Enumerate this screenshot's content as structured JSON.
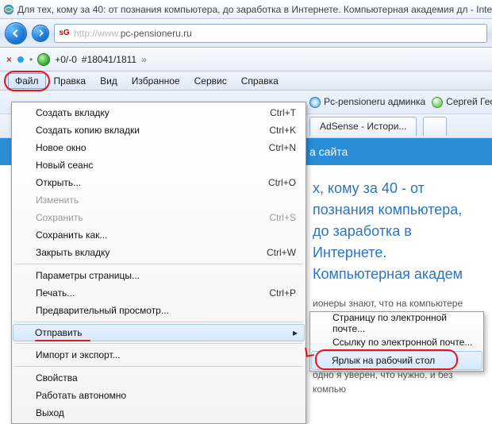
{
  "window": {
    "title": "Для тех, кому за 40: от познания компьютера, до заработка в Интернете. Компьютерная академия дл - Inte"
  },
  "address": {
    "favicon_label": "sG",
    "url_display": "pc-pensioneru.ru",
    "url_prefix": "http://www."
  },
  "toolbar2": {
    "close_x": "×",
    "zoom": "+0/-0",
    "counter": "#18041/1811",
    "chev": "»"
  },
  "menubar": {
    "file": "Файл",
    "edit": "Правка",
    "view": "Вид",
    "favorites": "Избранное",
    "tools": "Сервис",
    "help": "Справка"
  },
  "linksbar": {
    "item1": "Pc-pensioneru админка",
    "item2": "Сергей Гео"
  },
  "tabsbar": {
    "tab1": "AdSense - Истори..."
  },
  "page": {
    "bluebar": "а сайта",
    "heading": "х, кому за 40 - от познания компьютера, до заработка в Интернете. Компьютерная академ",
    "p1": "ионеры знают, что на компьютере можно играть в разные игры. О других возможностях большинство не знает и",
    "p2": "одно я уверен, что нужно, и без компью"
  },
  "file_menu": [
    {
      "label": "Создать вкладку",
      "shortcut": "Ctrl+T",
      "enabled": true
    },
    {
      "label": "Создать копию вкладки",
      "shortcut": "Ctrl+K",
      "enabled": true
    },
    {
      "label": "Новое окно",
      "shortcut": "Ctrl+N",
      "enabled": true
    },
    {
      "label": "Новый сеанс",
      "shortcut": "",
      "enabled": true
    },
    {
      "label": "Открыть...",
      "shortcut": "Ctrl+O",
      "enabled": true
    },
    {
      "label": "Изменить",
      "shortcut": "",
      "enabled": false
    },
    {
      "label": "Сохранить",
      "shortcut": "Ctrl+S",
      "enabled": false
    },
    {
      "label": "Сохранить как...",
      "shortcut": "",
      "enabled": true
    },
    {
      "label": "Закрыть вкладку",
      "shortcut": "Ctrl+W",
      "enabled": true
    },
    {
      "sep": true
    },
    {
      "label": "Параметры страницы...",
      "shortcut": "",
      "enabled": true
    },
    {
      "label": "Печать...",
      "shortcut": "Ctrl+P",
      "enabled": true
    },
    {
      "label": "Предварительный просмотр...",
      "shortcut": "",
      "enabled": true
    },
    {
      "sep": true
    },
    {
      "label": "Отправить",
      "shortcut": "",
      "enabled": true,
      "submenu": true,
      "hover": true,
      "redline": true
    },
    {
      "sep": true
    },
    {
      "label": "Импорт и экспорт...",
      "shortcut": "",
      "enabled": true
    },
    {
      "sep": true
    },
    {
      "label": "Свойства",
      "shortcut": "",
      "enabled": true
    },
    {
      "label": "Работать автономно",
      "shortcut": "",
      "enabled": true
    },
    {
      "label": "Выход",
      "shortcut": "",
      "enabled": true
    }
  ],
  "send_submenu": [
    {
      "label": "Страницу по электронной почте..."
    },
    {
      "label": "Ссылку по электронной почте..."
    },
    {
      "label": "Ярлык на рабочий стол",
      "selected": true,
      "red_highlight": true
    }
  ]
}
